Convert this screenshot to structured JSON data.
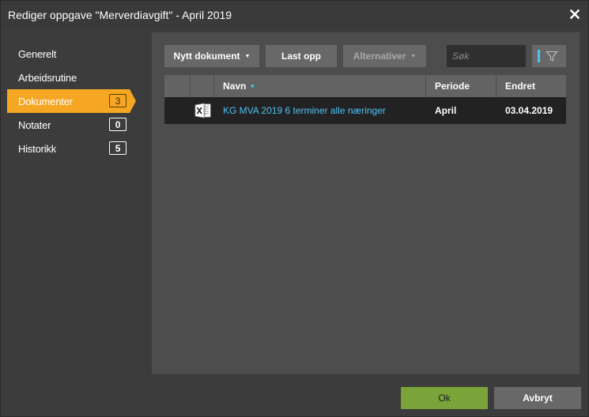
{
  "dialog": {
    "title": "Rediger oppgave \"Merverdiavgift\" - April 2019",
    "close_icon": "close-icon"
  },
  "sidebar": {
    "items": [
      {
        "label": "Generelt",
        "badge": null
      },
      {
        "label": "Arbeidsrutine",
        "badge": null
      },
      {
        "label": "Dokumenter",
        "badge": "3",
        "active": true
      },
      {
        "label": "Notater",
        "badge": "0"
      },
      {
        "label": "Historikk",
        "badge": "5"
      }
    ]
  },
  "toolbar": {
    "new_document_label": "Nytt dokument",
    "upload_label": "Last opp",
    "alternatives_label": "Alternativer",
    "search_placeholder": "Søk",
    "filter_icon": "filter-icon"
  },
  "table": {
    "columns": [
      "",
      "",
      "Navn",
      "Periode",
      "Endret"
    ],
    "sort_column": "Navn",
    "rows": [
      {
        "icon": "excel-icon",
        "name": "KG MVA 2019 6 terminer alle næringer",
        "period": "April",
        "changed": "03.04.2019"
      }
    ]
  },
  "footer": {
    "ok_label": "Ok",
    "cancel_label": "Avbryt"
  },
  "colors": {
    "accent": "#f5a623",
    "link": "#4fc3f7",
    "ok_button": "#7aa33a"
  }
}
